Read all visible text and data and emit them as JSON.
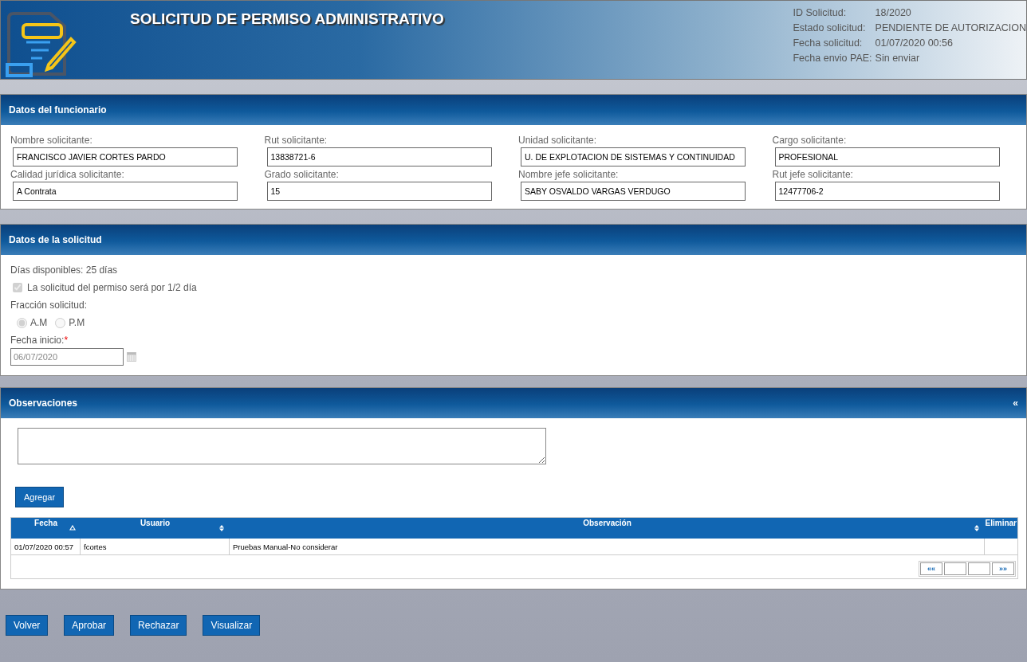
{
  "header": {
    "title": "SOLICITUD DE PERMISO ADMINISTRATIVO",
    "info": [
      {
        "label": "ID Solicitud:",
        "value": "18/2020"
      },
      {
        "label": "Estado solicitud:",
        "value": "PENDIENTE DE AUTORIZACION"
      },
      {
        "label": "Fecha solicitud:",
        "value": "01/07/2020 00:56"
      },
      {
        "label": "Fecha envio PAE:",
        "value": "Sin enviar"
      }
    ]
  },
  "funcionario": {
    "title": "Datos del funcionario",
    "fields": [
      {
        "label": "Nombre solicitante:",
        "value": "FRANCISCO JAVIER CORTES PARDO"
      },
      {
        "label": "Rut solicitante:",
        "value": "13838721-6"
      },
      {
        "label": "Unidad solicitante:",
        "value": "U. DE EXPLOTACION DE SISTEMAS Y CONTINUIDAD"
      },
      {
        "label": "Cargo solicitante:",
        "value": "PROFESIONAL"
      },
      {
        "label": "Calidad jurídica solicitante:",
        "value": "A Contrata"
      },
      {
        "label": "Grado solicitante:",
        "value": "15"
      },
      {
        "label": "Nombre jefe solicitante:",
        "value": "SABY OSVALDO VARGAS VERDUGO"
      },
      {
        "label": "Rut jefe solicitante:",
        "value": "12477706-2"
      }
    ]
  },
  "solicitud": {
    "title": "Datos de la solicitud",
    "dias": "Días disponibles: 25 días",
    "half_day": {
      "label": "La solicitud del permiso será por 1/2 día",
      "checked": true,
      "disabled": true
    },
    "fraccion_label": "Fracción solicitud:",
    "fraccion_options": [
      {
        "label": "A.M",
        "selected": true
      },
      {
        "label": "P.M",
        "selected": false
      }
    ],
    "fecha_label": "Fecha inicio:",
    "required_mark": "*",
    "fecha_value": "06/07/2020",
    "fecha_disabled": true
  },
  "observaciones": {
    "title": "Observaciones",
    "collapse": "«",
    "add_button": "Agregar",
    "columns": [
      {
        "label": "Fecha",
        "sortable": true,
        "ascending": true
      },
      {
        "label": "Usuario",
        "sortable": true,
        "ascending": false
      },
      {
        "label": "Observación",
        "sortable": true,
        "ascending": false
      },
      {
        "label": "Eliminar",
        "sortable": false
      }
    ],
    "rows": [
      [
        "01/07/2020 00:57",
        "fcortes",
        "Pruebas Manual-No considerar",
        ""
      ]
    ],
    "pager": {
      "first": "««",
      "last": "»»"
    }
  },
  "buttons": [
    "Volver",
    "Aprobar",
    "Rechazar",
    "Visualizar"
  ]
}
